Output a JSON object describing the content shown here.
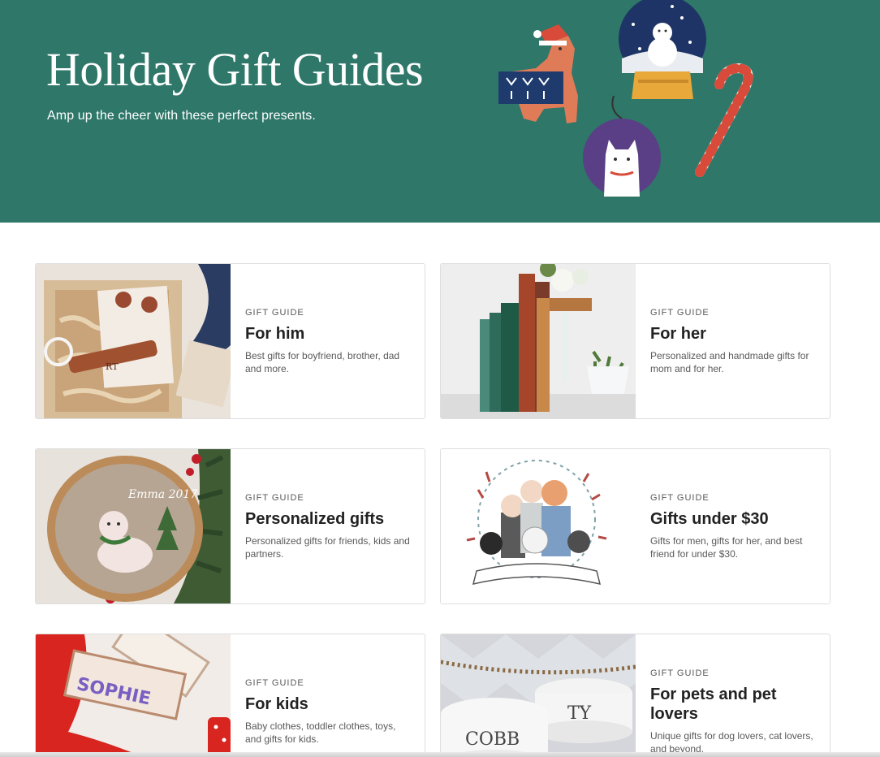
{
  "hero": {
    "title": "Holiday Gift Guides",
    "subtitle": "Amp up the cheer with these perfect presents.",
    "background_color": "#2e7769"
  },
  "cards": [
    {
      "eyebrow": "GIFT GUIDE",
      "title": "For him",
      "description": "Best gifts for boyfriend, brother, dad and more.",
      "image_text": "RT"
    },
    {
      "eyebrow": "GIFT GUIDE",
      "title": "For her",
      "description": "Personalized and handmade gifts for mom and for her."
    },
    {
      "eyebrow": "GIFT GUIDE",
      "title": "Personalized gifts",
      "description": "Personalized gifts for friends, kids and partners.",
      "image_text": "Emma 2017"
    },
    {
      "eyebrow": "GIFT GUIDE",
      "title": "Gifts under $30",
      "description": "Gifts for men, gifts for her, and best friend for under $30."
    },
    {
      "eyebrow": "GIFT GUIDE",
      "title": "For kids",
      "description": "Baby clothes, toddler clothes, toys, and gifts for kids.",
      "image_text": "SOPHIE"
    },
    {
      "eyebrow": "GIFT GUIDE",
      "title": "For pets and pet lovers",
      "description": "Unique gifts for dog lovers, cat lovers, and beyond.",
      "image_text_1": "COBB",
      "image_text_2": "TY"
    }
  ]
}
